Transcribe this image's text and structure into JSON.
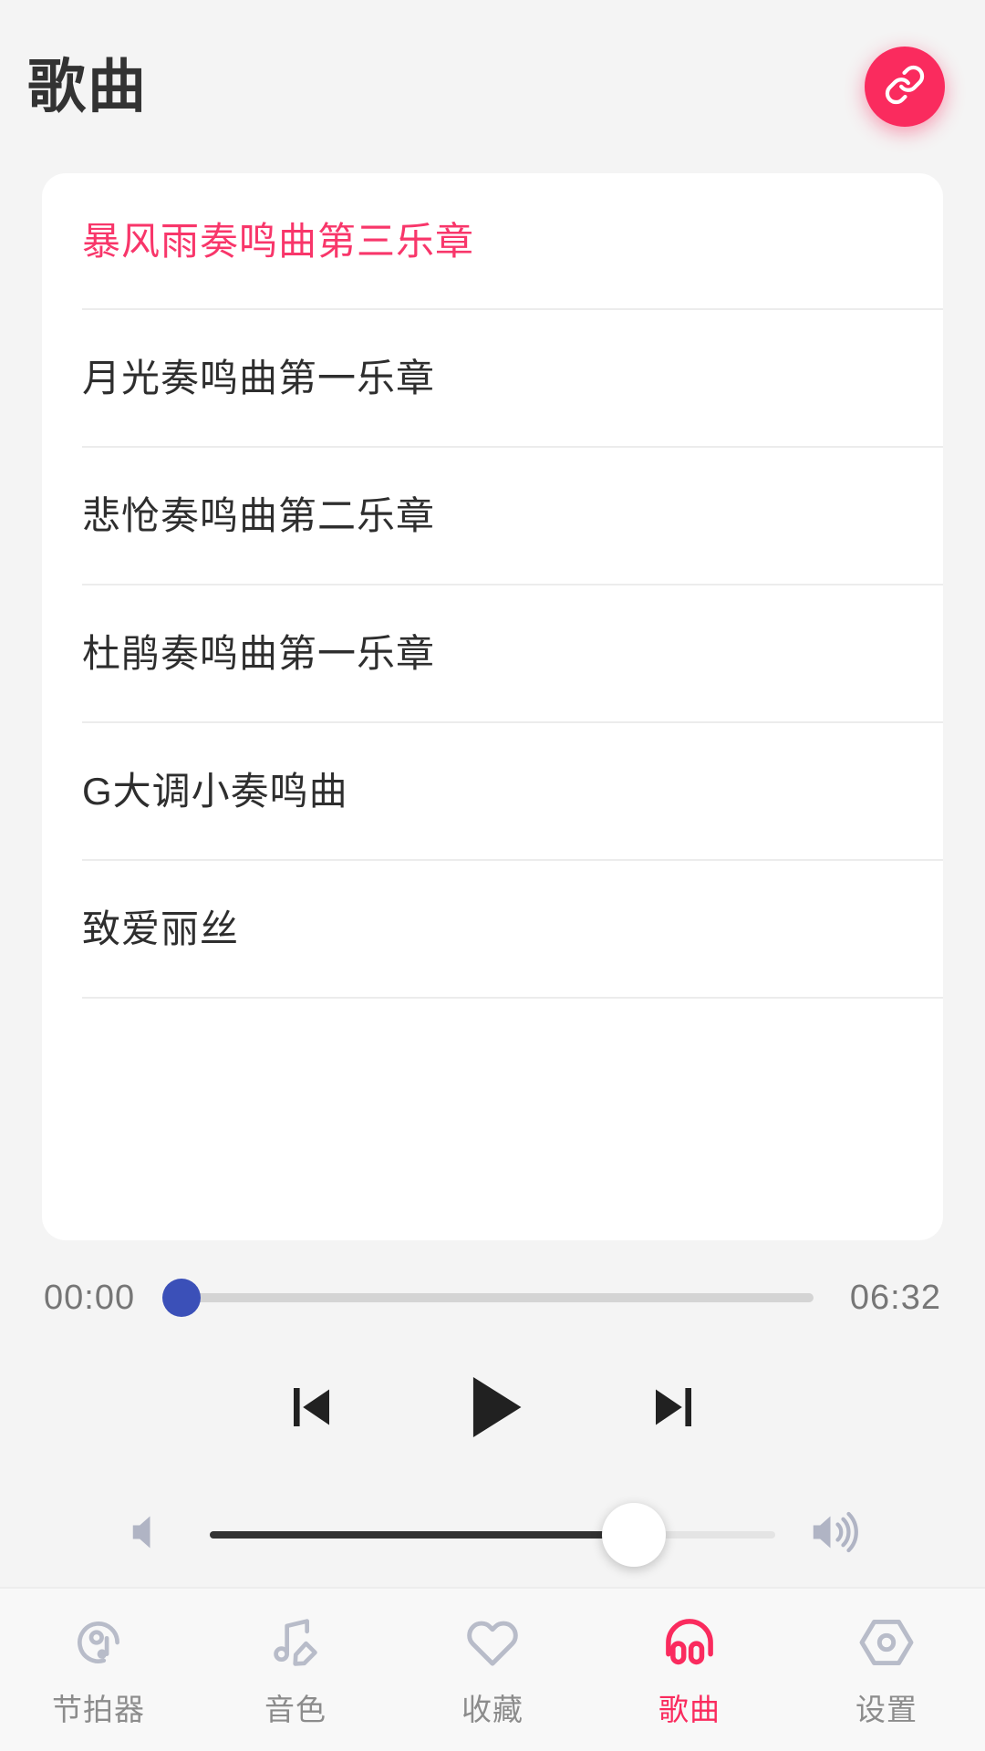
{
  "header": {
    "title": "歌曲",
    "link_button_icon": "link-icon"
  },
  "songs": {
    "items": [
      {
        "title": "暴风雨奏鸣曲第三乐章",
        "active": true
      },
      {
        "title": "月光奏鸣曲第一乐章",
        "active": false
      },
      {
        "title": "悲怆奏鸣曲第二乐章",
        "active": false
      },
      {
        "title": "杜鹃奏鸣曲第一乐章",
        "active": false
      },
      {
        "title": "G大调小奏鸣曲",
        "active": false
      },
      {
        "title": "致爱丽丝",
        "active": false
      }
    ]
  },
  "player": {
    "current_time": "00:00",
    "total_time": "06:32",
    "progress_percent": 0,
    "volume_percent": 75,
    "prev_icon": "skip-previous-icon",
    "play_icon": "play-icon",
    "next_icon": "skip-next-icon",
    "volume_mute_icon": "volume-mute-icon",
    "volume_up_icon": "volume-up-icon"
  },
  "colors": {
    "accent": "#fa2b5e",
    "active_song": "#f8366a",
    "progress_thumb": "#3b50b8",
    "background": "#f4f4f4",
    "card": "#ffffff",
    "nav_inactive": "#b8bcc9"
  },
  "bottom_nav": {
    "items": [
      {
        "label": "节拍器",
        "icon": "metronome-icon",
        "active": false
      },
      {
        "label": "音色",
        "icon": "music-edit-icon",
        "active": false
      },
      {
        "label": "收藏",
        "icon": "heart-icon",
        "active": false
      },
      {
        "label": "歌曲",
        "icon": "headphones-icon",
        "active": true
      },
      {
        "label": "设置",
        "icon": "settings-hex-icon",
        "active": false
      }
    ]
  }
}
